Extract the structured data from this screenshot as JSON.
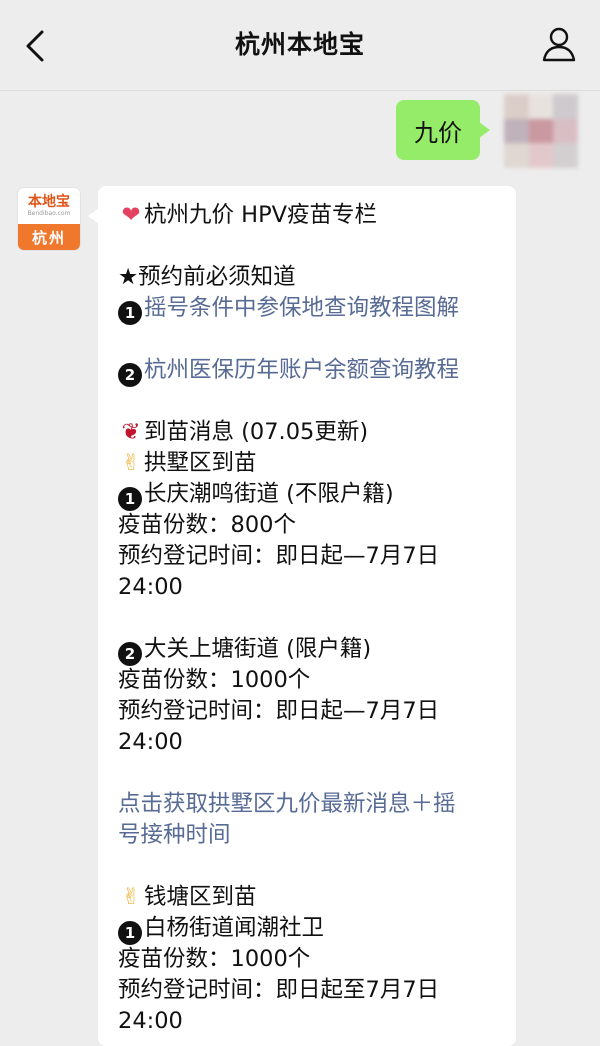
{
  "nav": {
    "title": "杭州本地宝",
    "back_icon": "chevron-left-icon",
    "profile_icon": "person-icon"
  },
  "sent_message": {
    "text": "九价"
  },
  "bot": {
    "avatar_top": "本地宝",
    "avatar_sub": "Bendibao.com",
    "avatar_city": "杭州"
  },
  "message": {
    "title": "杭州九价 HPV疫苗专栏",
    "notice_title": "★预约前必须知道",
    "link1_num": "1",
    "link1": "摇号条件中参保地查询教程图解",
    "link2_num": "2",
    "link2": "杭州医保历年账户余额查询教程",
    "arrival": "到苗消息 (07.05更新)",
    "gongshu_title": "拱墅区到苗",
    "g1_num": "1",
    "g1_place": "长庆潮鸣街道 (不限户籍)",
    "g1_count": "疫苗份数：800个",
    "g1_time": "预约登记时间：即日起—7月7日",
    "g1_time2": "24:00",
    "g2_num": "2",
    "g2_place": "大关上塘街道 (限户籍)",
    "g2_count": "疫苗份数：1000个",
    "g2_time": "预约登记时间：即日起—7月7日",
    "g2_time2": "24:00",
    "more_link1": "点击获取拱墅区九价最新消息＋摇",
    "more_link2": "号接种时间",
    "qiantang_title": "钱塘区到苗",
    "q1_num": "1",
    "q1_place": "白杨街道闻潮社卫",
    "q1_count": "疫苗份数：1000个",
    "q1_time": "预约登记时间：即日起至7月7日",
    "q1_time2": "24:00"
  },
  "colors": {
    "background": "#ededed",
    "sent_bubble": "#95ec69",
    "link": "#576b95",
    "brand": "#f0782d"
  }
}
